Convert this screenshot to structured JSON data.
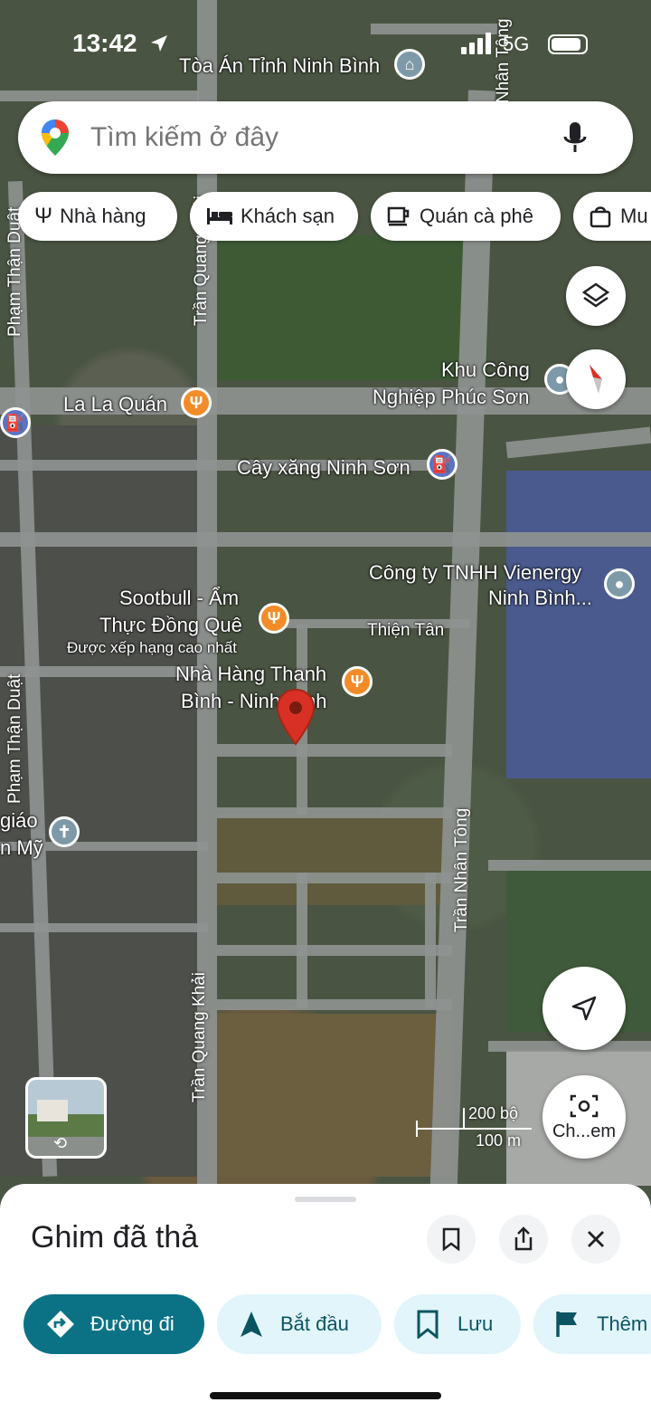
{
  "status_bar": {
    "time": "13:42",
    "network": "5G"
  },
  "search": {
    "placeholder": "Tìm kiếm ở đây"
  },
  "chips": [
    {
      "label": "Nhà hàng",
      "icon": "utensils-icon"
    },
    {
      "label": "Khách sạn",
      "icon": "bed-icon"
    },
    {
      "label": "Quán cà phê",
      "icon": "coffee-icon"
    },
    {
      "label": "Mu",
      "icon": "shopping-bag-icon"
    }
  ],
  "map": {
    "places": {
      "toa_an": "Tòa Án Tỉnh Ninh Bình",
      "khu_cong_1": "Khu Công",
      "khu_cong_2": "Nghiệp Phúc Sơn",
      "la_la": "La La Quán",
      "cay_xang": "Cây xăng Ninh Sơn",
      "cong_ty_1": "Công ty TNHH Vienergy",
      "cong_ty_2": "Ninh Bình...",
      "sootbull_1": "Sootbull - Ẩm",
      "sootbull_2": "Thực Đồng Quê",
      "sootbull_3": "Được xếp hạng cao nhất",
      "thien_tan": "Thiện Tân",
      "nha_hang_1": "Nhà Hàng Thanh",
      "nha_hang_2": "Bình - Ninh Bình",
      "giao_1": "giáo",
      "giao_2": "n Mỹ"
    },
    "streets": {
      "pham_than_duat": "Phạm Thận Duật",
      "tran_quang_khai": "Trần Quang Khải",
      "tran_nhan_tong": "Trần Nhân Tông",
      "nhan_tong_top": "n Nhân Tông"
    },
    "scale": {
      "imperial": "200 bộ",
      "metric": "100 m"
    },
    "lens_label": "Ch...em"
  },
  "sheet": {
    "title": "Ghim đã thả",
    "actions": [
      {
        "label": "Đường đi",
        "icon": "directions-icon"
      },
      {
        "label": "Bắt đầu",
        "icon": "navigation-arrow-icon"
      },
      {
        "label": "Lưu",
        "icon": "bookmark-icon"
      },
      {
        "label": "Thêm",
        "icon": "flag-icon"
      }
    ]
  },
  "colors": {
    "accent": "#0b7285",
    "action_bg": "#e1f5fb",
    "pin": "#d93025",
    "poi_orange": "#f28c28"
  }
}
